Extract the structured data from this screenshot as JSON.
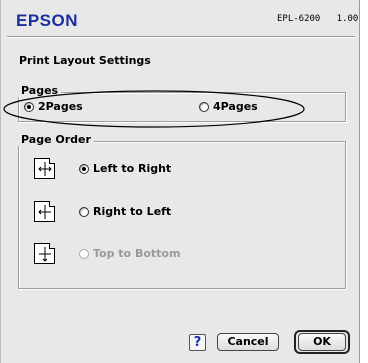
{
  "header": {
    "brand": "EPSON",
    "model": "EPL-6200   1.00"
  },
  "title": "Print Layout Settings",
  "pages": {
    "label": "Pages",
    "options": [
      {
        "label": "2Pages",
        "checked": true
      },
      {
        "label": "4Pages",
        "checked": false
      }
    ]
  },
  "page_order": {
    "label": "Page Order",
    "options": [
      {
        "label": "Left to Right",
        "checked": true,
        "enabled": true,
        "icon": "left-to-right-icon"
      },
      {
        "label": "Right to Left",
        "checked": false,
        "enabled": true,
        "icon": "right-to-left-icon"
      },
      {
        "label": "Top to Bottom",
        "checked": false,
        "enabled": false,
        "icon": "top-to-bottom-icon"
      }
    ]
  },
  "buttons": {
    "help": "?",
    "cancel": "Cancel",
    "ok": "OK"
  },
  "colors": {
    "brand": "#1b2f9e",
    "background": "#e8e8e8",
    "disabled_text": "#9a9a9a"
  }
}
